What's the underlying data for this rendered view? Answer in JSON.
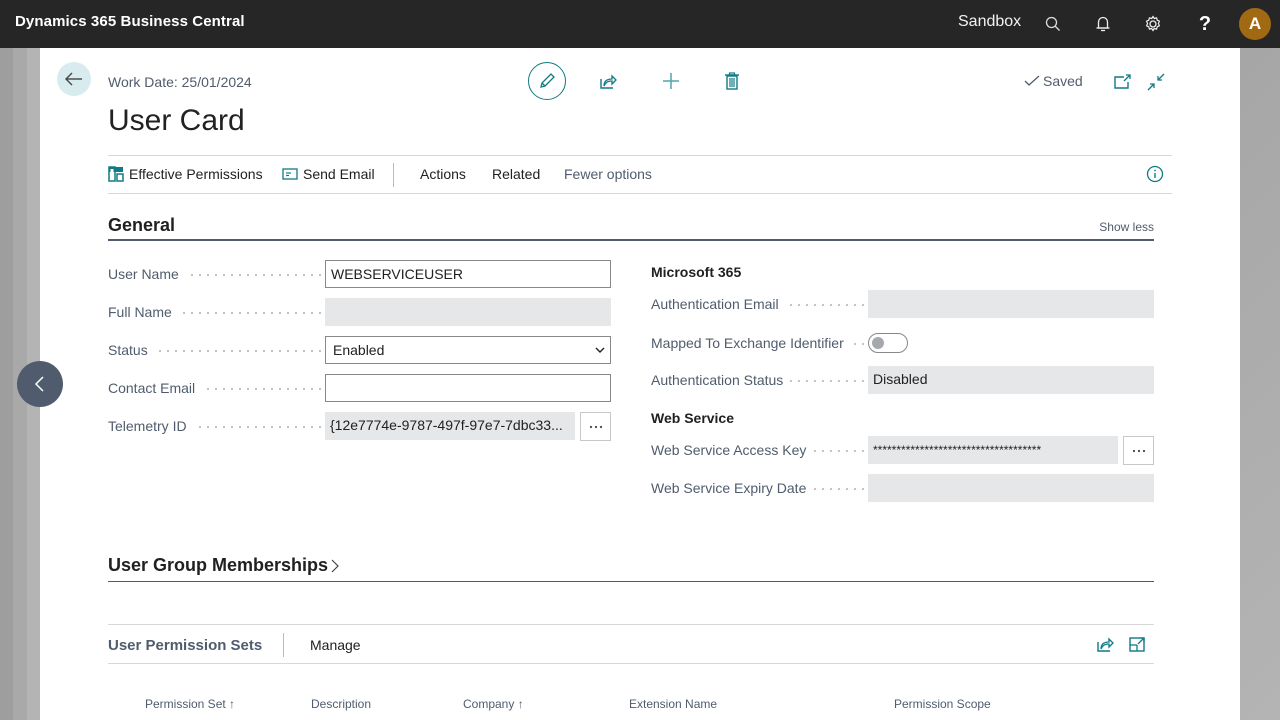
{
  "app": {
    "title": "Dynamics 365 Business Central",
    "environment": "Sandbox",
    "avatar_initial": "A",
    "icons": [
      "search-icon",
      "bell-icon",
      "gear-icon",
      "help-icon"
    ]
  },
  "header": {
    "work_date": "Work Date: 25/01/2024",
    "page_title": "User Card",
    "saved_status": "Saved"
  },
  "action_bar": {
    "effective_permissions": "Effective Permissions",
    "send_email": "Send Email",
    "actions": "Actions",
    "related": "Related",
    "fewer_options": "Fewer options"
  },
  "general": {
    "title": "General",
    "show_less": "Show less",
    "left_fields": [
      {
        "label": "User Name",
        "value": "WEBSERVICEUSER",
        "type": "input"
      },
      {
        "label": "Full Name",
        "value": "",
        "type": "readonly"
      },
      {
        "label": "Status",
        "value": "Enabled",
        "type": "select"
      },
      {
        "label": "Contact Email",
        "value": "",
        "type": "input"
      },
      {
        "label": "Telemetry ID",
        "value": "{12e7774e-9787-497f-97e7-7dbc33...",
        "type": "readonly-lookup"
      }
    ],
    "microsoft365": {
      "title": "Microsoft 365",
      "fields": [
        {
          "label": "Authentication Email",
          "value": ""
        },
        {
          "label": "Mapped To Exchange Identifier",
          "value": false
        },
        {
          "label": "Authentication Status",
          "value": "Disabled"
        }
      ]
    },
    "web_service": {
      "title": "Web Service",
      "fields": [
        {
          "label": "Web Service Access Key",
          "value": "************************************"
        },
        {
          "label": "Web Service Expiry Date",
          "value": ""
        }
      ]
    }
  },
  "user_group_memberships": {
    "title": "User Group Memberships"
  },
  "user_permission_sets": {
    "title": "User Permission Sets",
    "manage": "Manage",
    "columns": [
      "Permission Set ↑",
      "Description",
      "Company ↑",
      "Extension Name",
      "Permission Scope"
    ]
  },
  "colors": {
    "topbar": "#262626",
    "accent": "#0f7b84",
    "avatar": "#a16a12",
    "label": "#505c6d",
    "readonly_bg": "#e6e7e9"
  }
}
